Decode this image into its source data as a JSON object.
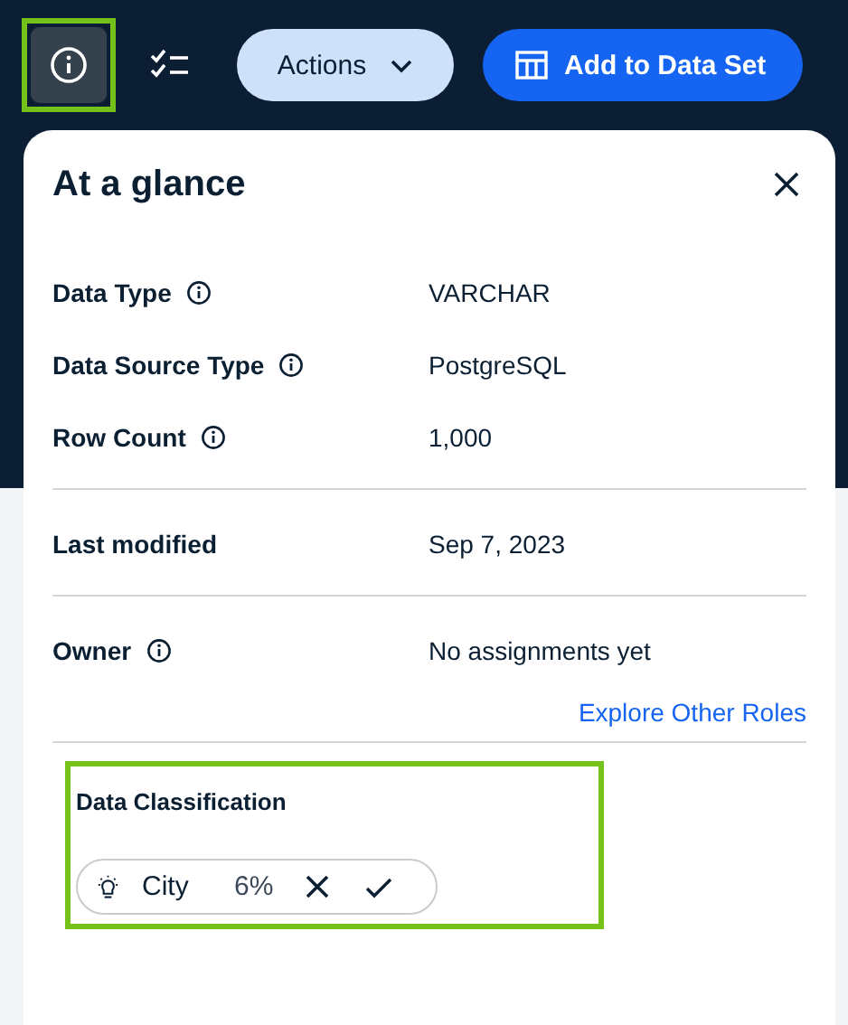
{
  "toolbar": {
    "info_button": {
      "selected": true,
      "highlighted": true
    },
    "actions_button": {
      "label": "Actions"
    },
    "primary_button": {
      "label": "Add to Data Set"
    }
  },
  "panel": {
    "title": "At a glance",
    "groups": [
      {
        "rows": [
          {
            "label": "Data Type",
            "info": true,
            "value": "VARCHAR"
          },
          {
            "label": "Data Source Type",
            "info": true,
            "value": "PostgreSQL"
          },
          {
            "label": "Row Count",
            "info": true,
            "value": "1,000"
          }
        ]
      },
      {
        "rows": [
          {
            "label": "Last modified",
            "info": false,
            "value": "Sep 7, 2023"
          }
        ]
      },
      {
        "rows": [
          {
            "label": "Owner",
            "info": true,
            "value": "No assignments yet"
          }
        ],
        "link": "Explore Other Roles"
      }
    ],
    "classification": {
      "title": "Data Classification",
      "highlighted": true,
      "suggestion": {
        "label": "City",
        "confidence": "6%"
      }
    }
  }
}
